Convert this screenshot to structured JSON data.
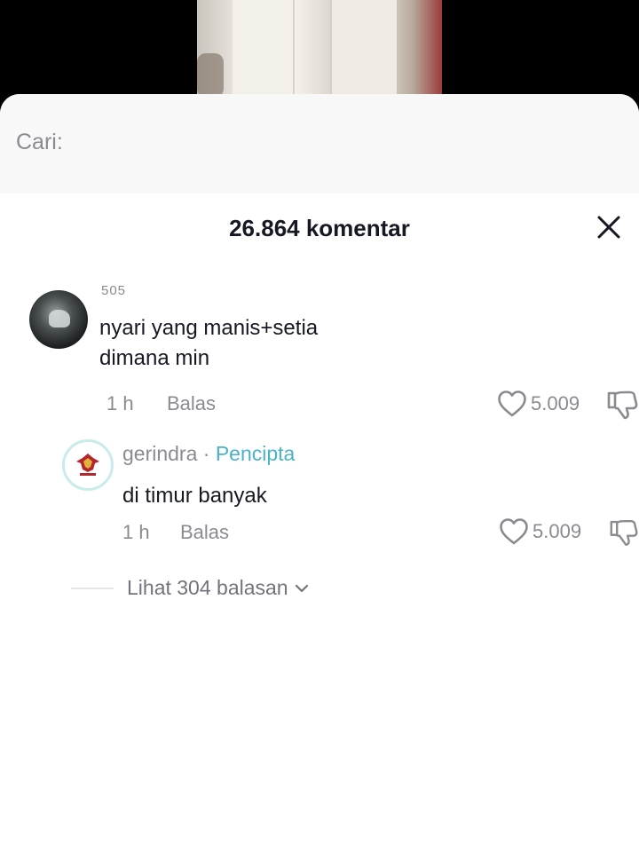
{
  "search": {
    "label": "Cari:"
  },
  "comments_header": {
    "title": "26.864 komentar"
  },
  "comment": {
    "username": "505",
    "text_line1": "nyari yang manis+setia",
    "text_line2": "dimana min",
    "time": "1 h",
    "reply_label": "Balas",
    "likes": "5.009"
  },
  "reply": {
    "username": "gerindra",
    "separator": " · ",
    "creator_label": "Pencipta",
    "text": "di timur banyak",
    "time": "1 h",
    "reply_label": "Balas",
    "likes": "5.009"
  },
  "view_replies": {
    "label": "Lihat 304 balasan"
  },
  "icons": {
    "close": "close-icon",
    "like": "heart-outline-icon",
    "dislike": "thumbs-down-icon",
    "chevron": "chevron-down-icon",
    "logo": "garuda-logo-icon"
  },
  "colors": {
    "creator_accent": "#48b3c7",
    "text_primary": "#161823",
    "text_secondary": "#8a8b91",
    "logo_red": "#b3262b",
    "logo_gold": "#e2b23a"
  }
}
